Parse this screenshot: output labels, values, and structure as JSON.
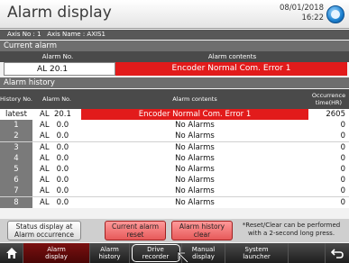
{
  "title": "Alarm display",
  "clock": {
    "date": "08/01/2018",
    "time": "16:22"
  },
  "axis_bar": "Axis No : 1   Axis Name : AXIS1",
  "current_alarm": {
    "section": "Current alarm",
    "col_no": "Alarm No.",
    "col_contents": "Alarm contents",
    "alarm_no": "AL 20.1",
    "alarm_contents": "Encoder Normal Com. Error 1"
  },
  "history": {
    "section": "Alarm history",
    "col_history_no": "History No.",
    "col_alarm_no": "Alarm No.",
    "col_contents": "Alarm contents",
    "col_time": "Occurrence time(HR)",
    "rows": [
      {
        "no": "latest",
        "alarm_no": "AL  20.1",
        "contents": "Encoder Normal Com. Error 1",
        "time": "2605"
      },
      {
        "no": "1",
        "alarm_no": "AL   0.0",
        "contents": "No Alarms",
        "time": "0"
      },
      {
        "no": "2",
        "alarm_no": "AL   0.0",
        "contents": "No Alarms",
        "time": "0"
      },
      {
        "no": "3",
        "alarm_no": "AL   0.0",
        "contents": "No Alarms",
        "time": "0"
      },
      {
        "no": "4",
        "alarm_no": "AL   0.0",
        "contents": "No Alarms",
        "time": "0"
      },
      {
        "no": "5",
        "alarm_no": "AL   0.0",
        "contents": "No Alarms",
        "time": "0"
      },
      {
        "no": "6",
        "alarm_no": "AL   0.0",
        "contents": "No Alarms",
        "time": "0"
      },
      {
        "no": "7",
        "alarm_no": "AL   0.0",
        "contents": "No Alarms",
        "time": "0"
      },
      {
        "no": "8",
        "alarm_no": "AL   0.0",
        "contents": "No Alarms",
        "time": "0"
      }
    ]
  },
  "buttons": {
    "status_display_l1": "Status display at",
    "status_display_l2": "Alarm occurrence",
    "current_reset_l1": "Current alarm",
    "current_reset_l2": "reset",
    "history_clear_l1": "Alarm history",
    "history_clear_l2": "clear",
    "note_l1": "*Reset/Clear can be performed",
    "note_l2": "with a 2-second long press."
  },
  "nav": {
    "alarm_display_l1": "Alarm",
    "alarm_display_l2": "display",
    "alarm_history_l1": "Alarm",
    "alarm_history_l2": "history",
    "drive_recorder_l1": "Drive",
    "drive_recorder_l2": "recorder",
    "manual_display_l1": "Manual",
    "manual_display_l2": "display",
    "system_launcher_l1": "System",
    "system_launcher_l2": "launcher"
  },
  "colors": {
    "alarm_red": "#e21b1b",
    "header_gray": "#4a4a4a",
    "nav_active": "#7a1010"
  },
  "icons": {
    "home": "home-icon",
    "back": "back-arrow-icon",
    "clock": "clock-icon",
    "cursor": "pointer-cursor-icon"
  }
}
